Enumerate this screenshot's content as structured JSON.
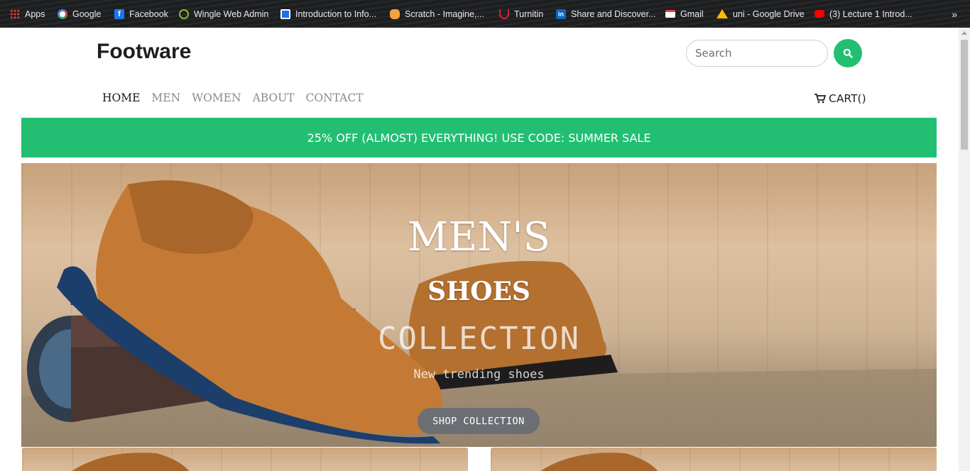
{
  "bookmarks": [
    {
      "label": "Apps",
      "icon": "apps-grid-icon",
      "color": "#ea4335"
    },
    {
      "label": "Google",
      "icon": "google-icon",
      "color": "#4285f4"
    },
    {
      "label": "Facebook",
      "icon": "facebook-icon",
      "color": "#1877f2"
    },
    {
      "label": "Wingle Web Admin",
      "icon": "wingle-icon",
      "color": "#8ab833"
    },
    {
      "label": "Introduction to Info...",
      "icon": "classroom-icon",
      "color": "#1a73e8"
    },
    {
      "label": "Scratch - Imagine,...",
      "icon": "scratch-icon",
      "color": "#f4a23b"
    },
    {
      "label": "Turnitin",
      "icon": "turnitin-icon",
      "color": "#d3232f"
    },
    {
      "label": "Share and Discover...",
      "icon": "linkedin-icon",
      "color": "#0a66c2"
    },
    {
      "label": "Gmail",
      "icon": "gmail-icon",
      "color": "#ea4335"
    },
    {
      "label": "uni - Google Drive",
      "icon": "google-drive-icon",
      "color": "#fbbc04"
    },
    {
      "label": "(3) Lecture 1 Introd...",
      "icon": "youtube-icon",
      "color": "#ff0000"
    }
  ],
  "bookmarks_more": "»",
  "site": {
    "brand": "Footware",
    "search_placeholder": "Search",
    "search_value": "",
    "accent_color": "#22bf73"
  },
  "nav": {
    "items": [
      {
        "label": "HOME",
        "active": true
      },
      {
        "label": "MEN",
        "active": false
      },
      {
        "label": "WOMEN",
        "active": false
      },
      {
        "label": "ABOUT",
        "active": false
      },
      {
        "label": "CONTACT",
        "active": false
      }
    ],
    "cart_label": "CART()"
  },
  "promo": {
    "text": "25% OFF (ALMOST) EVERYTHING! USE CODE: SUMMER SALE"
  },
  "hero": {
    "line1": "MEN'S",
    "line2": "SHOES",
    "line3": "COLLECTION",
    "line4": "New trending shoes",
    "button_label": "SHOP COLLECTION"
  }
}
